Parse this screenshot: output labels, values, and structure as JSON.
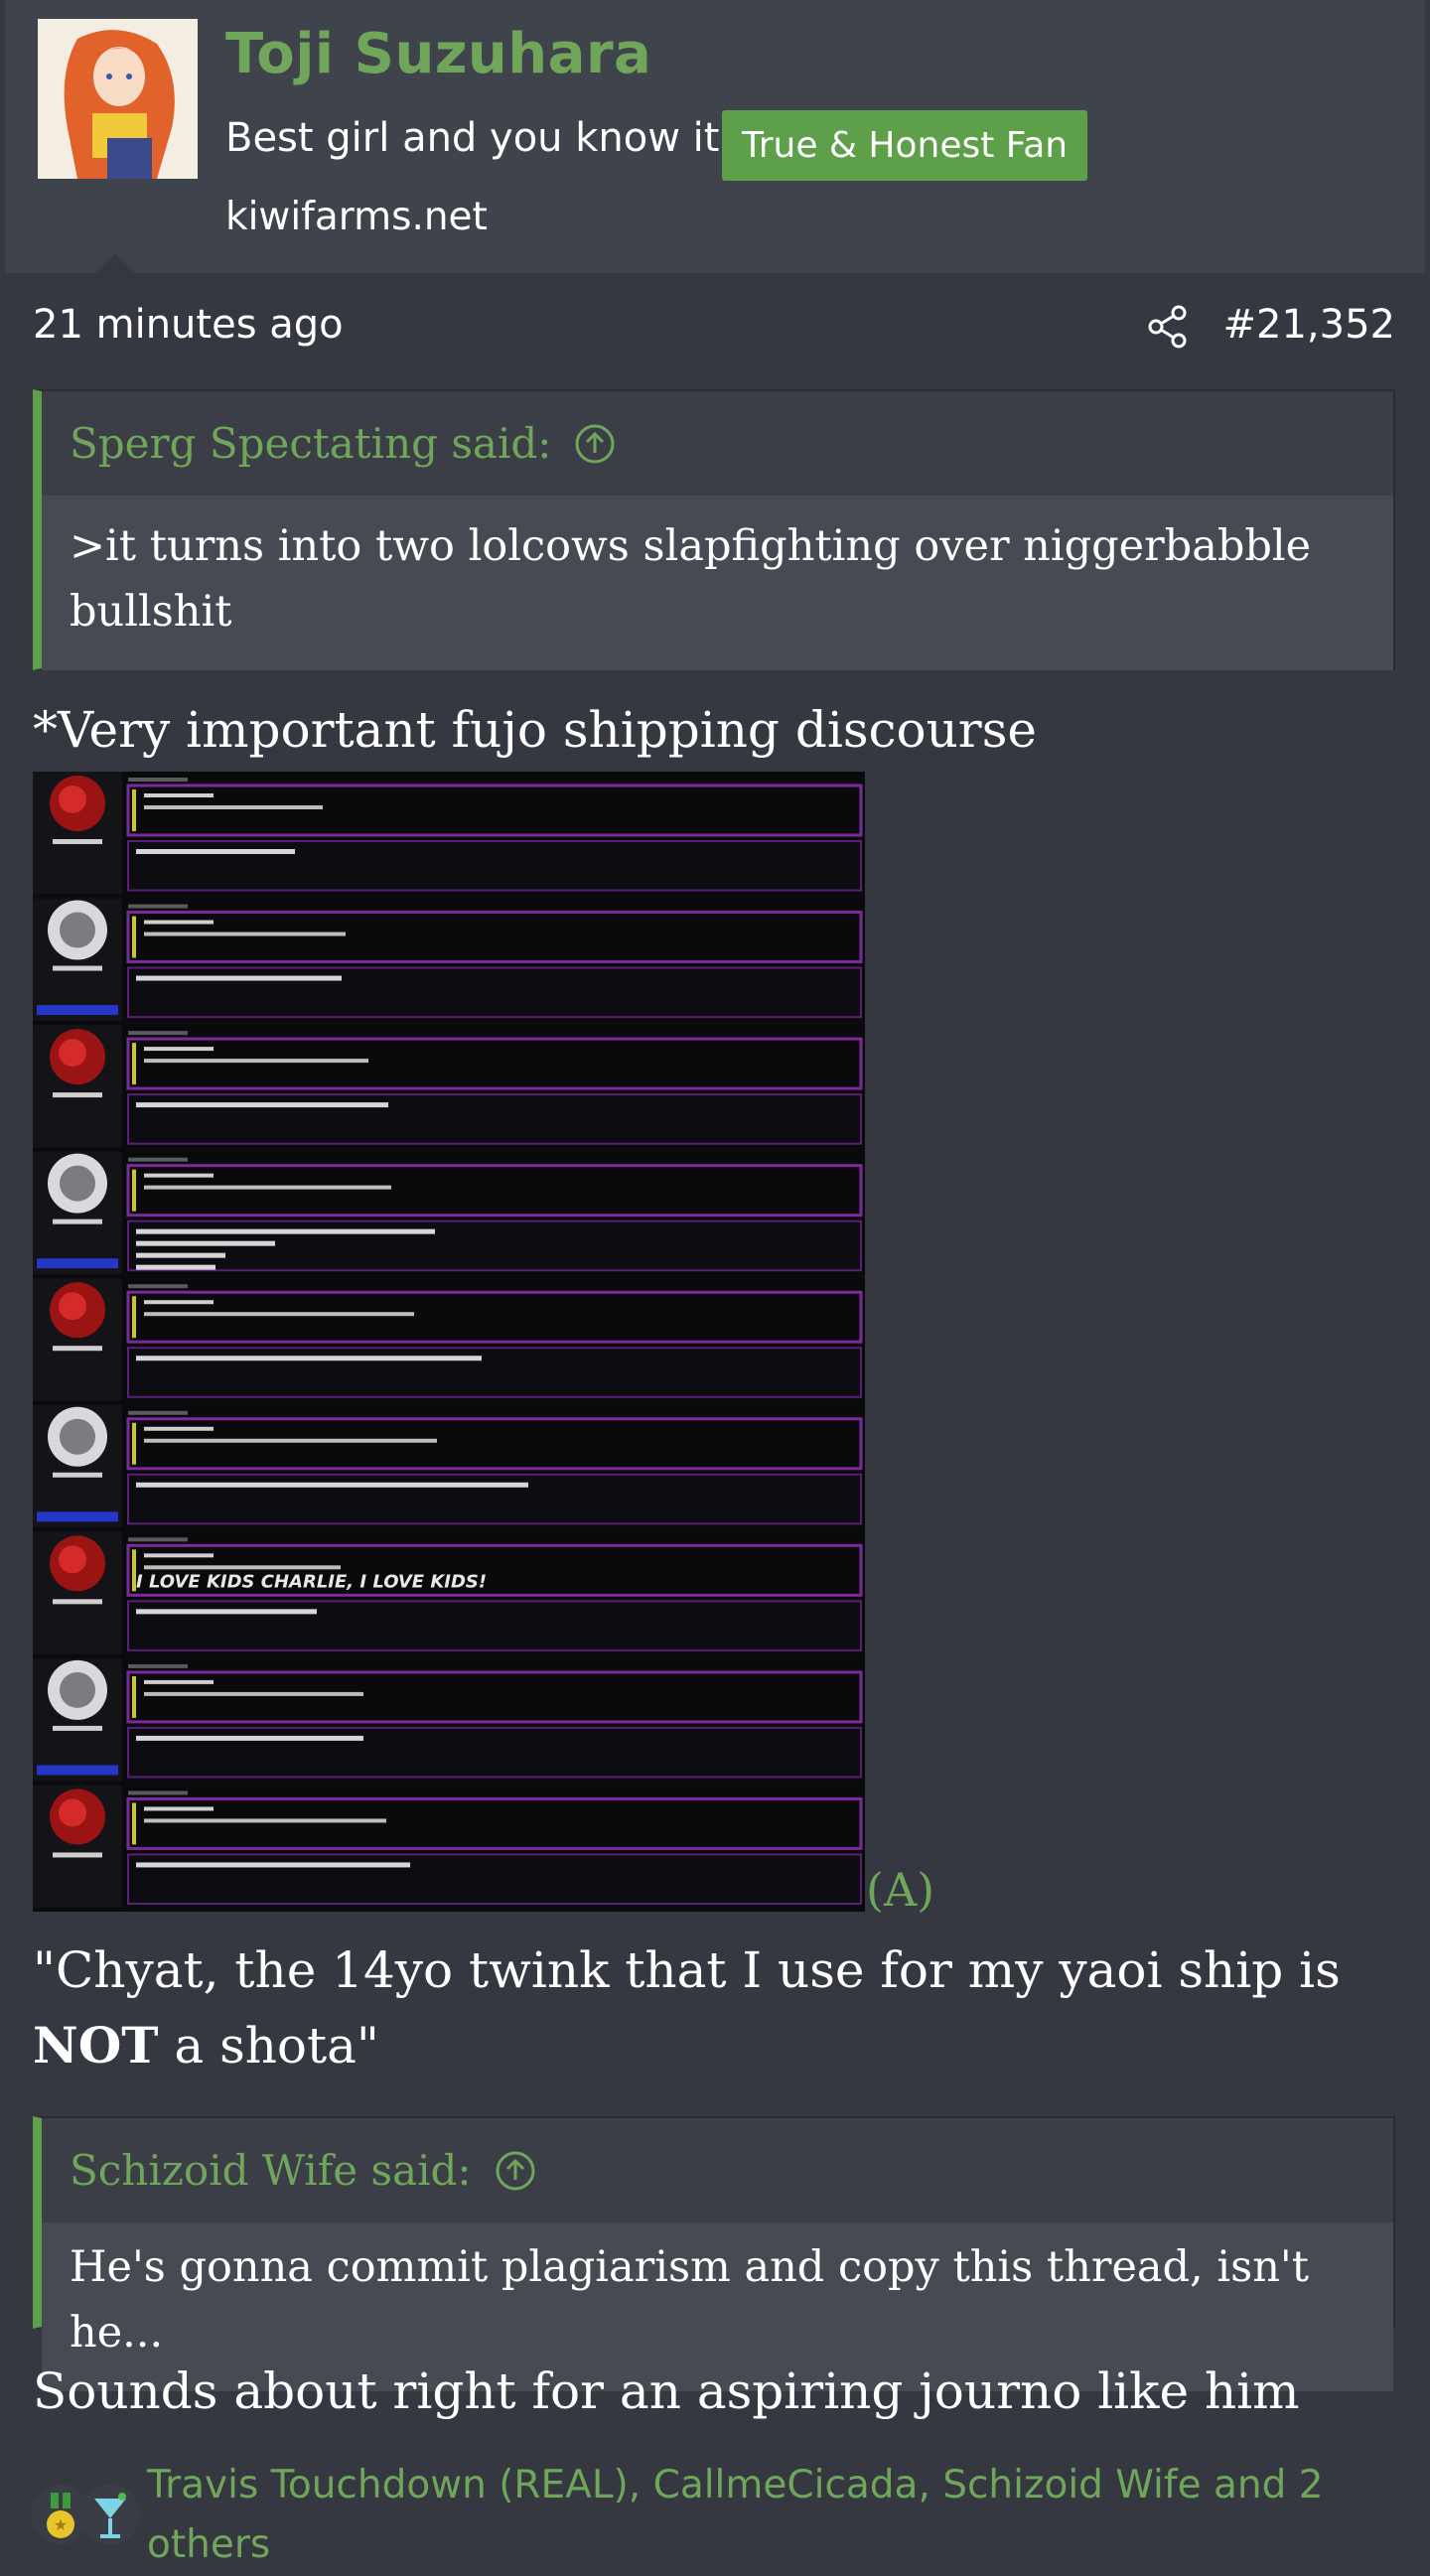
{
  "user": {
    "name": "Toji Suzuhara",
    "title": "Best girl and you know it",
    "badge": "True & Honest Fan",
    "site": "kiwifarms.net"
  },
  "post": {
    "time": "21 minutes ago",
    "number": "#21,352"
  },
  "quotes": [
    {
      "author": "Sperg Spectating said:",
      "text": ">it turns into two lolcows slapfighting over niggerbabble bullshit"
    },
    {
      "author": "Schizoid Wife said:",
      "text": "He's gonna commit plagiarism and copy this thread, isn't he..."
    }
  ],
  "body": {
    "line1": "*Very important fujo shipping discourse",
    "attachment_label": "(A)",
    "line2_pre": "\"Chyat, the 14yo twink that I use for my yaoi ship is ",
    "line2_bold": "NOT",
    "line2_post": " a shota\"",
    "line3": "Sounds about right for an aspiring journo like him"
  },
  "screenshot_embedded": {
    "highlight": "I LOVE KIDS CHARLIE, I LOVE KIDS!"
  },
  "reactions": {
    "icons": [
      "medal-icon",
      "cocktail-icon"
    ],
    "names": "Travis Touchdown (REAL), CallmeCicada, Schizoid Wife and 2 others"
  },
  "colors": {
    "accent": "#6fa65a",
    "badge": "#5ea04a",
    "background": "#353840",
    "header": "#3f434b"
  }
}
